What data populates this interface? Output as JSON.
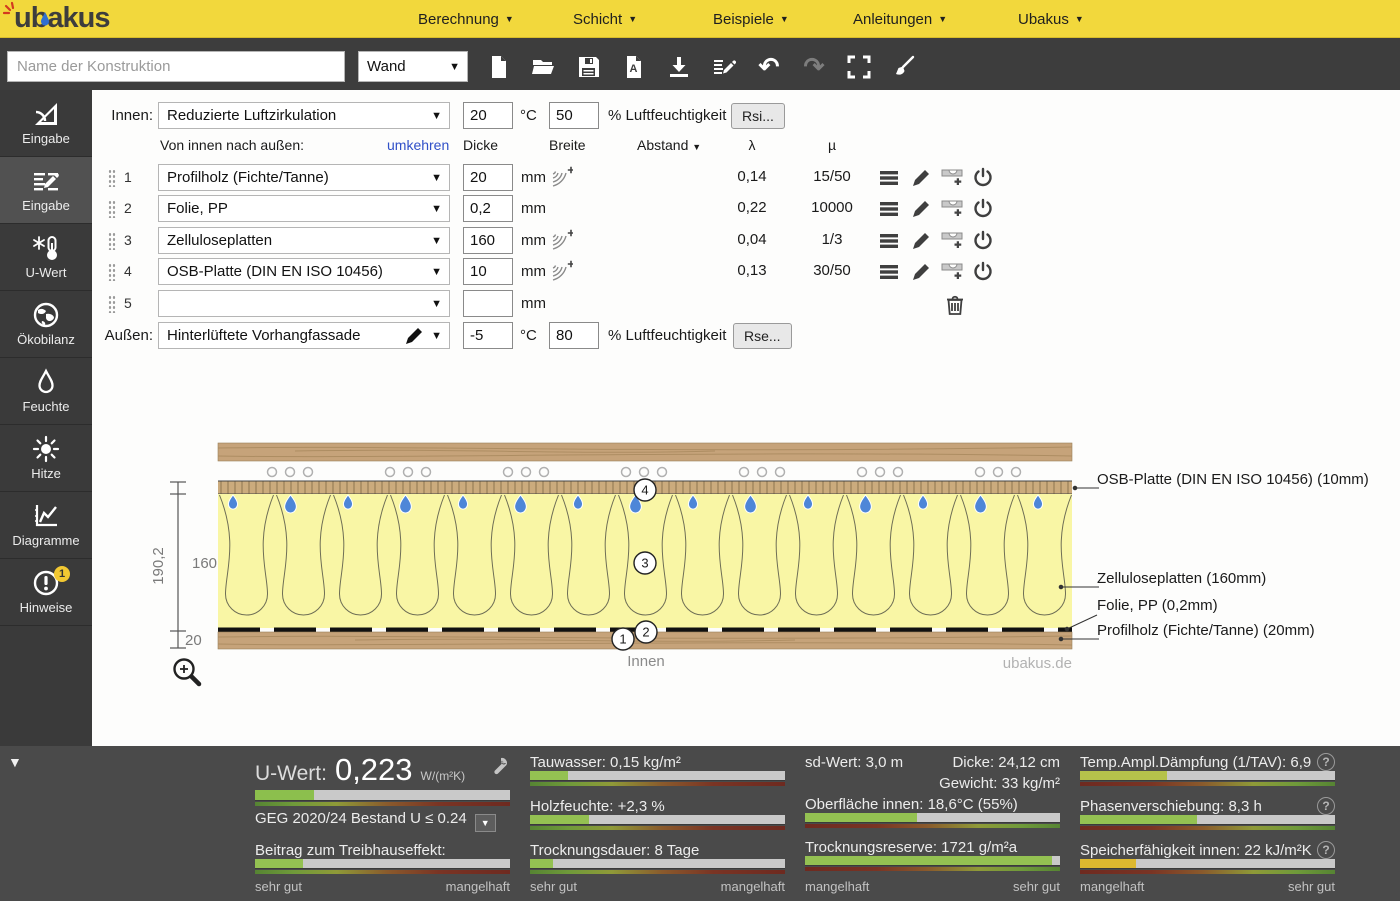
{
  "colors": {
    "brand_yellow": "#f2d83c",
    "bar_green": "#94c152",
    "accent_blue": "#4e86d8"
  },
  "menubar": {
    "logo": "ubakus",
    "items": [
      {
        "label": "Berechnung"
      },
      {
        "label": "Schicht"
      },
      {
        "label": "Beispiele"
      },
      {
        "label": "Anleitungen"
      },
      {
        "label": "Ubakus"
      }
    ]
  },
  "toolbar": {
    "name_placeholder": "Name der Konstruktion",
    "type_value": "Wand",
    "icons": [
      "new-document",
      "open-folder",
      "save",
      "export-pdf",
      "download",
      "edit-name",
      "undo",
      "redo",
      "fullscreen",
      "brush"
    ]
  },
  "sidebar": {
    "items": [
      {
        "label": "Eingabe",
        "icon": "drawing-tools-icon"
      },
      {
        "label": "Eingabe",
        "icon": "edit-list-icon",
        "active": true
      },
      {
        "label": "U-Wert",
        "icon": "frost-thermometer-icon"
      },
      {
        "label": "Ökobilanz",
        "icon": "globe-icon"
      },
      {
        "label": "Feuchte",
        "icon": "droplet-icon"
      },
      {
        "label": "Hitze",
        "icon": "sun-icon"
      },
      {
        "label": "Diagramme",
        "icon": "chart-icon"
      },
      {
        "label": "Hinweise",
        "icon": "alert-icon",
        "badge": "1"
      }
    ]
  },
  "form": {
    "innen": {
      "label": "Innen:",
      "value": "Reduzierte Luftzirkulation",
      "temp": "20",
      "temp_unit": "°C",
      "humidity": "50",
      "humidity_label": "% Luftfeuchtigkeit",
      "button": "Rsi..."
    },
    "header": {
      "direction": "Von innen nach außen:",
      "reverse_link": "umkehren",
      "dicke": "Dicke",
      "breite": "Breite",
      "abstand": "Abstand",
      "lambda": "λ",
      "mu": "µ"
    },
    "layers": [
      {
        "num": "1",
        "material": "Profilholz (Fichte/Tanne)",
        "dicke": "20",
        "unit": "mm",
        "lambda": "0,14",
        "mu": "15/50"
      },
      {
        "num": "2",
        "material": "Folie, PP",
        "dicke": "0,2",
        "unit": "mm",
        "lambda": "0,22",
        "mu": "10000"
      },
      {
        "num": "3",
        "material": "Zelluloseplatten",
        "dicke": "160",
        "unit": "mm",
        "lambda": "0,04",
        "mu": "1/3"
      },
      {
        "num": "4",
        "material": "OSB-Platte (DIN EN ISO 10456)",
        "dicke": "10",
        "unit": "mm",
        "lambda": "0,13",
        "mu": "30/50"
      },
      {
        "num": "5",
        "material": "",
        "dicke": "",
        "unit": "mm"
      }
    ],
    "aussen": {
      "label": "Außen:",
      "value": "Hinterlüftete Vorhangfassade",
      "temp": "-5",
      "temp_unit": "°C",
      "humidity": "80",
      "humidity_label": "% Luftfeuchtigkeit",
      "button": "Rse..."
    }
  },
  "diagram": {
    "dim_total": "190,2",
    "dim_insulation": "160",
    "dim_bottom": "20",
    "innen_label": "Innen",
    "watermark": "ubakus.de",
    "layer_numbers": [
      "1",
      "2",
      "3",
      "4"
    ],
    "labels": [
      {
        "text": "OSB-Platte (DIN EN ISO 10456) (10mm)"
      },
      {
        "text": "Zelluloseplatten (160mm)"
      },
      {
        "text": "Folie, PP (0,2mm)"
      },
      {
        "text": "Profilholz (Fichte/Tanne) (20mm)"
      }
    ]
  },
  "results": {
    "metrics": {
      "uwert": {
        "label": "U-Wert:",
        "value": "0,223",
        "unit": "W/(m²K)",
        "bar_pct": "23%",
        "bar_color": "#8cbf4d",
        "standard_label": "GEG 2020/24 Bestand U ≤ 0.24"
      },
      "treibhaus": {
        "label": "Beitrag zum Treibhauseffekt:",
        "bar_pct": "19%",
        "bar_color": "#94c152"
      },
      "tauwasser": {
        "label": "Tauwasser:",
        "value": "0,15 kg/m²",
        "bar_pct": "15%",
        "bar_color": "#94c152"
      },
      "holzfeuchte": {
        "label": "Holzfeuchte:",
        "value": "+2,3 %",
        "bar_pct": "23%",
        "bar_color": "#94c152"
      },
      "trocknungsdauer": {
        "label": "Trocknungsdauer:",
        "value": "8 Tage",
        "bar_pct": "9%",
        "bar_color": "#94c152"
      },
      "sdwert": {
        "label": "sd-Wert:",
        "value": "3,0 m"
      },
      "dicke": {
        "label": "Dicke:",
        "value": "24,12 cm"
      },
      "gewicht": {
        "label": "Gewicht:",
        "value": "33 kg/m²"
      },
      "oberflaeche": {
        "label": "Oberfläche innen:",
        "value": "18,6°C (55%)",
        "bar_pct": "44%",
        "bar_color": "#94c152"
      },
      "trocknungsreserve": {
        "label": "Trocknungsreserve:",
        "value": "1721 g/m²a",
        "bar_pct": "97%",
        "bar_color": "#94c152"
      },
      "tav": {
        "label": "Temp.Ampl.Dämpfung (1/TAV):",
        "value": "6,9",
        "bar_pct": "34%",
        "bar_color": "#b5c24b"
      },
      "phase": {
        "label": "Phasenverschiebung:",
        "value": "8,3 h",
        "bar_pct": "46%",
        "bar_color": "#94c152"
      },
      "speicher": {
        "label": "Speicherfähigkeit innen:",
        "value": "22 kJ/m²K",
        "bar_pct": "22%",
        "bar_color": "#ddb92f"
      }
    },
    "scale_good": "sehr gut",
    "scale_bad": "mangelhaft"
  }
}
